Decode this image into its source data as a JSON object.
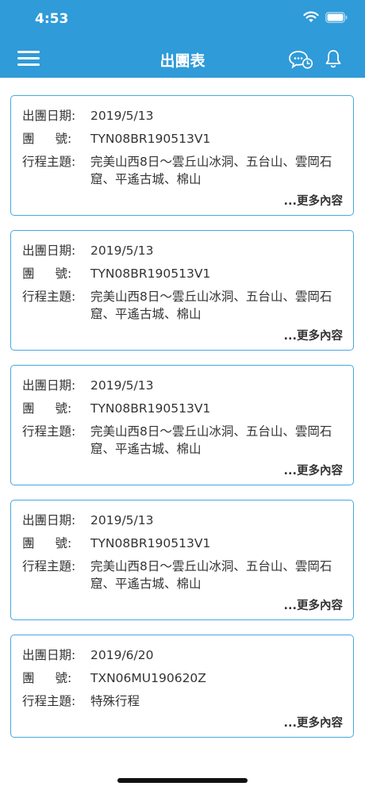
{
  "status": {
    "time": "4:53"
  },
  "header": {
    "title": "出團表"
  },
  "labels": {
    "date": "出團日期:",
    "tour_no_a": "團",
    "tour_no_b": "號:",
    "theme": "行程主題:",
    "more": "...更多內容"
  },
  "cards": [
    {
      "date": "2019/5/13",
      "tour_no": "TYN08BR190513V1",
      "theme": "完美山西8日～雲丘山冰洞、五台山、雲岡石窟、平遙古城、棉山"
    },
    {
      "date": "2019/5/13",
      "tour_no": "TYN08BR190513V1",
      "theme": "完美山西8日～雲丘山冰洞、五台山、雲岡石窟、平遙古城、棉山"
    },
    {
      "date": "2019/5/13",
      "tour_no": "TYN08BR190513V1",
      "theme": "完美山西8日～雲丘山冰洞、五台山、雲岡石窟、平遙古城、棉山"
    },
    {
      "date": "2019/5/13",
      "tour_no": "TYN08BR190513V1",
      "theme": "完美山西8日～雲丘山冰洞、五台山、雲岡石窟、平遙古城、棉山"
    },
    {
      "date": "2019/6/20",
      "tour_no": "TXN06MU190620Z",
      "theme": "特殊行程"
    }
  ],
  "colors": {
    "header_bg": "#2f9bd9",
    "card_border": "#46a8de"
  }
}
